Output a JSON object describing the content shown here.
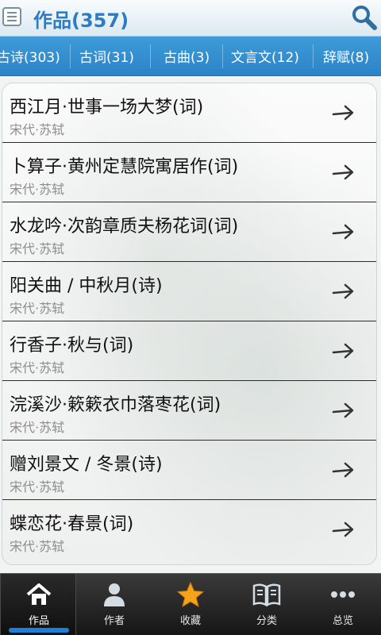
{
  "header": {
    "title": "作品(357)",
    "menu_icon": "menu-icon",
    "search_icon": "search-icon"
  },
  "tabs": [
    {
      "label": "古诗(303)"
    },
    {
      "label": "古词(31)"
    },
    {
      "label": "古曲(3)"
    },
    {
      "label": "文言文(12)"
    },
    {
      "label": "辞赋(8)"
    }
  ],
  "works": [
    {
      "title": "西江月·世事一场大梦(词)",
      "meta": "宋代·苏轼"
    },
    {
      "title": "卜算子·黄州定慧院寓居作(词)",
      "meta": "宋代·苏轼"
    },
    {
      "title": "水龙吟·次韵章质夫杨花词(词)",
      "meta": "宋代·苏轼"
    },
    {
      "title": "阳关曲 / 中秋月(诗)",
      "meta": "宋代·苏轼"
    },
    {
      "title": "行香子·秋与(词)",
      "meta": "宋代·苏轼"
    },
    {
      "title": "浣溪沙·簌簌衣巾落枣花(词)",
      "meta": "宋代·苏轼"
    },
    {
      "title": "赠刘景文 / 冬景(诗)",
      "meta": "宋代·苏轼"
    },
    {
      "title": "蝶恋花·春景(词)",
      "meta": "宋代·苏轼"
    }
  ],
  "bottom_nav": [
    {
      "label": "作品",
      "icon": "home-icon",
      "active": true
    },
    {
      "label": "作者",
      "icon": "user-icon",
      "active": false
    },
    {
      "label": "收藏",
      "icon": "star-icon",
      "active": false
    },
    {
      "label": "分类",
      "icon": "book-icon",
      "active": false
    },
    {
      "label": "总览",
      "icon": "more-icon",
      "active": false
    }
  ],
  "colors": {
    "title": "#2c7cc4",
    "tab_bar": "#3192d2",
    "star": "#f6a21a",
    "active_indicator": "#1d7fd8"
  }
}
